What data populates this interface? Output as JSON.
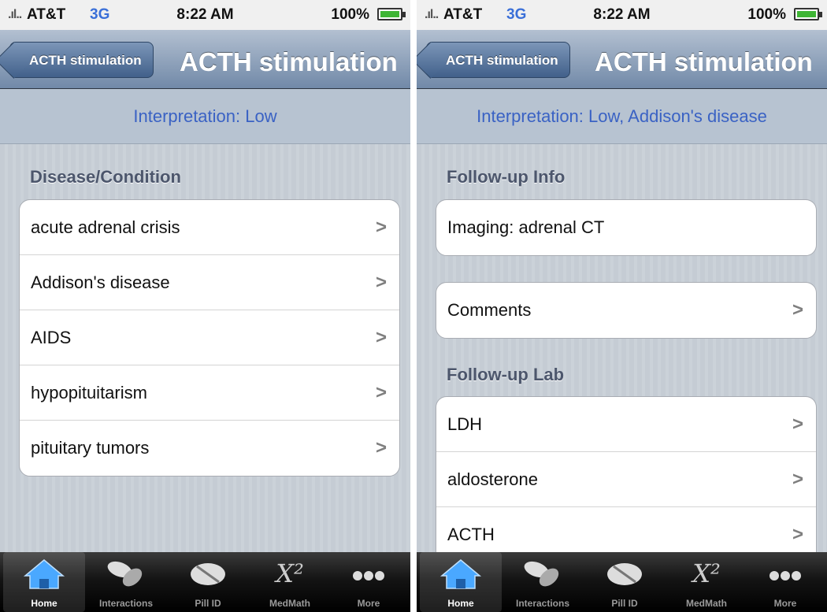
{
  "colors": {
    "accent": "#3a62c4",
    "tabbar_active": "#4aa8ff"
  },
  "screens": [
    {
      "status": {
        "signal": ".ıl..",
        "carrier": "AT&T",
        "network": "3G",
        "time": "8:22 AM",
        "battery": "100%"
      },
      "nav": {
        "back_label": "ACTH stimulation",
        "title": "ACTH stimulation"
      },
      "interpretation": "Interpretation: Low",
      "sections": [
        {
          "header": "Disease/Condition",
          "rows": [
            "acute adrenal crisis",
            "Addison's disease",
            "AIDS",
            "hypopituitarism",
            "pituitary tumors"
          ]
        }
      ],
      "tabs": [
        {
          "label": "Home",
          "icon": "home-icon"
        },
        {
          "label": "Interactions",
          "icon": "pills-icon"
        },
        {
          "label": "Pill ID",
          "icon": "pill-icon"
        },
        {
          "label": "MedMath",
          "icon": "x-squared-icon",
          "glyph": "X²"
        },
        {
          "label": "More",
          "icon": "more-icon"
        }
      ]
    },
    {
      "status": {
        "signal": ".ıl..",
        "carrier": "AT&T",
        "network": "3G",
        "time": "8:22 AM",
        "battery": "100%"
      },
      "nav": {
        "back_label": "ACTH stimulation",
        "title": "ACTH stimulation"
      },
      "interpretation": "Interpretation: Low, Addison's disease",
      "sections": [
        {
          "header": "Follow-up Info",
          "rows": [
            "Imaging: adrenal CT"
          ]
        },
        {
          "header": "",
          "rows": [
            "Comments"
          ]
        },
        {
          "header": "Follow-up Lab",
          "rows": [
            "LDH",
            "aldosterone",
            "ACTH"
          ]
        }
      ],
      "tabs": [
        {
          "label": "Home",
          "icon": "home-icon"
        },
        {
          "label": "Interactions",
          "icon": "pills-icon"
        },
        {
          "label": "Pill ID",
          "icon": "pill-icon"
        },
        {
          "label": "MedMath",
          "icon": "x-squared-icon",
          "glyph": "X²"
        },
        {
          "label": "More",
          "icon": "more-icon"
        }
      ]
    }
  ]
}
